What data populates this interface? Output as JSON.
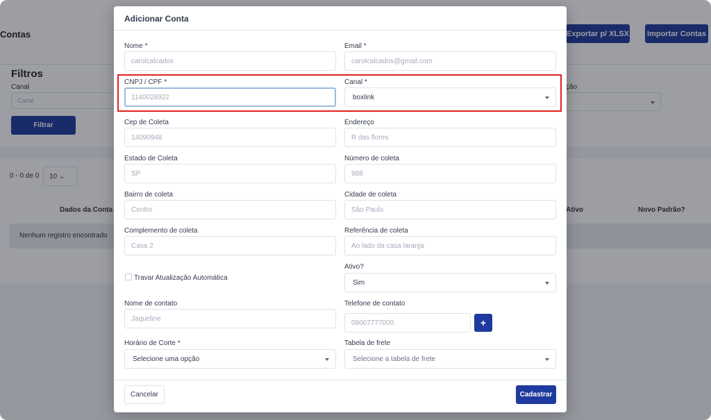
{
  "background": {
    "page_title": "Contas",
    "export_button": "Exportar p/ XLSX",
    "import_button": "Importar Contas",
    "filters_title": "Filtros",
    "canal_label": "Canal",
    "canal_placeholder": "Canal",
    "acao_label": "ção",
    "filter_button": "Filtrar",
    "pagination_text": "0 - 0 de 0",
    "page_size": "10",
    "columns": [
      "Dados da Conta",
      "Ativo",
      "Novo Padrão?"
    ],
    "empty_text": "Nenhum registro encontrado"
  },
  "modal": {
    "title": "Adicionar Conta",
    "fields": {
      "nome": {
        "label": "Nome *",
        "value": "carolcalcados"
      },
      "email": {
        "label": "Email *",
        "value": "carolcalcados@gmail.com"
      },
      "cnpj": {
        "label": "CNPJ / CPF *",
        "value": "1140028922"
      },
      "canal": {
        "label": "Canal *",
        "value": "boxlink"
      },
      "cep": {
        "label": "Cep de Coleta",
        "value": "14090948"
      },
      "endereco": {
        "label": "Endereço",
        "value": "R das flores"
      },
      "estado": {
        "label": "Estado de Coleta",
        "value": "SP"
      },
      "numero": {
        "label": "Número de coleta",
        "value": "988"
      },
      "bairro": {
        "label": "Bairro de coleta",
        "value": "Centro"
      },
      "cidade": {
        "label": "Cidade de coleta",
        "value": "São Paulo"
      },
      "complemento": {
        "label": "Complemento de coleta",
        "value": "Casa 2"
      },
      "referencia": {
        "label": "Referência de coleta",
        "value": "Ao lado da casa laranja"
      },
      "travar": {
        "label": "Travar Atualização Automática",
        "checked": false
      },
      "ativo": {
        "label": "Ativo?",
        "value": "Sim"
      },
      "contato": {
        "label": "Nome de contato",
        "value": "Jaqueline"
      },
      "telefone": {
        "label": "Telefone de contato",
        "value": "08007777000"
      },
      "horario": {
        "label": "Horário de Corte *",
        "value": "Selecione uma opção"
      },
      "tabela": {
        "label": "Tabela de frete",
        "value": "Selecione a tabela de frete"
      }
    },
    "add_phone_icon": "plus-icon",
    "cancel_button": "Cancelar",
    "submit_button": "Cadastrar"
  },
  "colors": {
    "primary": "#1f3a9e",
    "highlight": "#e02020",
    "focus_border": "#99b9df"
  }
}
